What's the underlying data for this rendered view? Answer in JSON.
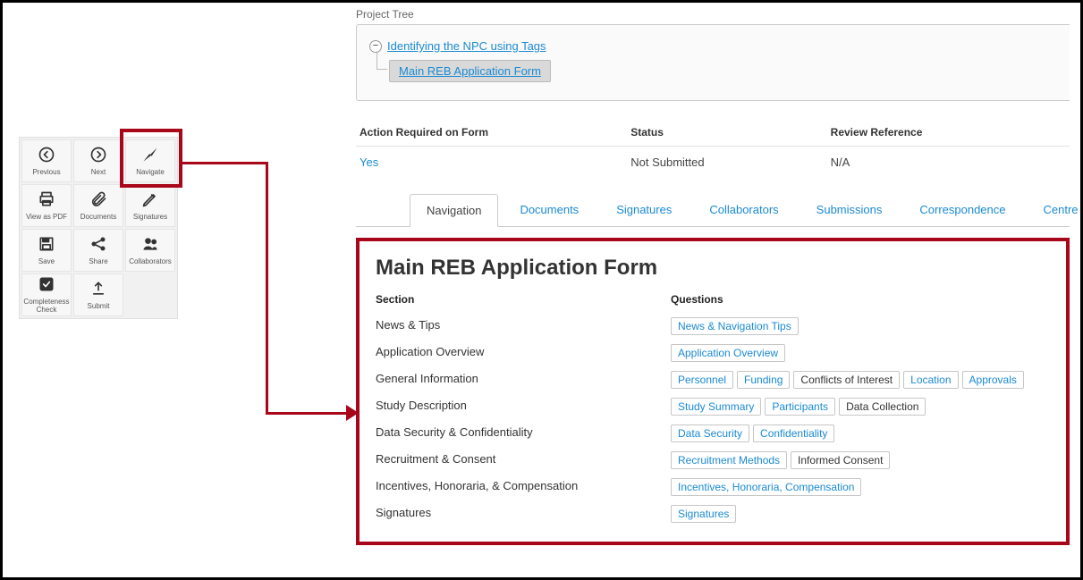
{
  "toolbar": [
    {
      "id": "previous-button",
      "label": "Previous",
      "icon": "arrow-left-circle"
    },
    {
      "id": "next-button",
      "label": "Next",
      "icon": "arrow-right-circle"
    },
    {
      "id": "navigate-button",
      "label": "Navigate",
      "icon": "compass-arrow"
    },
    {
      "id": "view-pdf-button",
      "label": "View as PDF",
      "icon": "printer"
    },
    {
      "id": "documents-button",
      "label": "Documents",
      "icon": "paperclip"
    },
    {
      "id": "signatures-button",
      "label": "Signatures",
      "icon": "pencil"
    },
    {
      "id": "save-button",
      "label": "Save",
      "icon": "floppy"
    },
    {
      "id": "share-button",
      "label": "Share",
      "icon": "share"
    },
    {
      "id": "collaborators-button",
      "label": "Collaborators",
      "icon": "people"
    },
    {
      "id": "completeness-check-button",
      "label": "Completeness\nCheck",
      "icon": "check-box"
    },
    {
      "id": "submit-button",
      "label": "Submit",
      "icon": "upload"
    }
  ],
  "project_tree": {
    "label": "Project Tree",
    "root": "Identifying the NPC using Tags",
    "child": "Main REB Application Form"
  },
  "status_columns": {
    "action": "Action Required on Form",
    "status": "Status",
    "review": "Review Reference"
  },
  "status_values": {
    "action": "Yes",
    "status": "Not Submitted",
    "review": "N/A"
  },
  "tabs": [
    "Navigation",
    "Documents",
    "Signatures",
    "Collaborators",
    "Submissions",
    "Correspondence",
    "Centre"
  ],
  "active_tab_index": 0,
  "nav_panel": {
    "title": "Main REB Application Form",
    "section_header": "Section",
    "questions_header": "Questions",
    "rows": [
      {
        "section": "News & Tips",
        "questions": [
          {
            "text": "News & Navigation Tips",
            "link": true
          }
        ]
      },
      {
        "section": "Application Overview",
        "questions": [
          {
            "text": "Application Overview",
            "link": true
          }
        ]
      },
      {
        "section": "General Information",
        "questions": [
          {
            "text": "Personnel",
            "link": true
          },
          {
            "text": "Funding",
            "link": true
          },
          {
            "text": "Conflicts of Interest",
            "link": false
          },
          {
            "text": "Location",
            "link": true
          },
          {
            "text": "Approvals",
            "link": true
          }
        ]
      },
      {
        "section": "Study Description",
        "questions": [
          {
            "text": "Study Summary",
            "link": true
          },
          {
            "text": "Participants",
            "link": true
          },
          {
            "text": "Data Collection",
            "link": false
          }
        ]
      },
      {
        "section": "Data Security & Confidentiality",
        "questions": [
          {
            "text": "Data Security",
            "link": true
          },
          {
            "text": "Confidentiality",
            "link": true
          }
        ]
      },
      {
        "section": "Recruitment & Consent",
        "questions": [
          {
            "text": "Recruitment Methods",
            "link": true
          },
          {
            "text": "Informed Consent",
            "link": false
          }
        ]
      },
      {
        "section": "Incentives, Honoraria, & Compensation",
        "questions": [
          {
            "text": "Incentives, Honoraria, Compensation",
            "link": true
          }
        ]
      },
      {
        "section": "Signatures",
        "questions": [
          {
            "text": "Signatures",
            "link": true
          }
        ]
      }
    ]
  }
}
